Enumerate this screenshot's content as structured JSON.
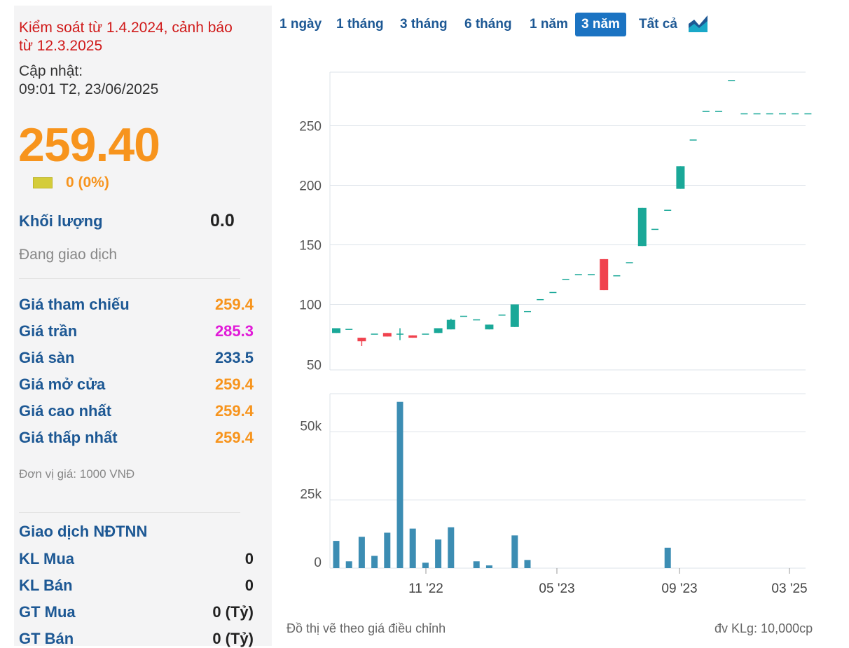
{
  "sidebar": {
    "warning": "Kiểm soát từ 1.4.2024, cảnh báo từ 12.3.2025",
    "update_label": "Cập nhật:",
    "update_time": "09:01 T2, 23/06/2025",
    "price": "259.40",
    "change": "0 (0%)",
    "volume_label": "Khối lượng",
    "volume_value": "0.0",
    "status": "Đang giao dịch",
    "stats": [
      {
        "label": "Giá tham chiếu",
        "value": "259.4",
        "color": "#f7941d"
      },
      {
        "label": "Giá trần",
        "value": "285.3",
        "color": "#e11bd8"
      },
      {
        "label": "Giá sàn",
        "value": "233.5",
        "color": "#1d5894"
      },
      {
        "label": "Giá mở cửa",
        "value": "259.4",
        "color": "#f7941d"
      },
      {
        "label": "Giá cao nhất",
        "value": "259.4",
        "color": "#f7941d"
      },
      {
        "label": "Giá thấp nhất",
        "value": "259.4",
        "color": "#f7941d"
      }
    ],
    "unit": "Đơn vị giá: 1000 VNĐ",
    "foreign_title": "Giao dịch NĐTNN",
    "foreign": [
      {
        "label": "KL Mua",
        "value": "0"
      },
      {
        "label": "KL Bán",
        "value": "0"
      },
      {
        "label": "GT Mua",
        "value": "0 (Tỷ)"
      },
      {
        "label": "GT Bán",
        "value": "0 (Tỷ)"
      }
    ]
  },
  "tabs": [
    "1 ngày",
    "1 tháng",
    "3 tháng",
    "6 tháng",
    "1 năm",
    "3 năm",
    "Tất cả"
  ],
  "active_tab": "3 năm",
  "chart_icon": "area-chart-icon",
  "footer": {
    "note": "Đồ thị vẽ theo giá điều chỉnh",
    "unit": "đv KLg: 10,000cp"
  },
  "colors": {
    "up": "#1aa898",
    "down": "#f0424e",
    "volume": "#3c8db3",
    "grid": "#dde3ea"
  },
  "chart_data": {
    "type": "candlestick",
    "x_ticks": [
      "11 '22",
      "05 '23",
      "09 '23",
      "03 '25"
    ],
    "price_axis": {
      "ticks": [
        50,
        100,
        150,
        200,
        250
      ],
      "ylim": [
        45,
        295
      ]
    },
    "volume_axis": {
      "ticks": [
        "0",
        "25k",
        "50k"
      ],
      "tick_values": [
        0,
        25000,
        50000
      ],
      "ylim": [
        0,
        64000
      ]
    },
    "candles": [
      {
        "open": 76,
        "close": 80,
        "high": 80,
        "low": 76
      },
      {
        "open": 79,
        "close": 79,
        "high": 79,
        "low": 79
      },
      {
        "open": 72,
        "close": 69,
        "high": 72,
        "low": 65
      },
      {
        "open": 75,
        "close": 75,
        "high": 75,
        "low": 75
      },
      {
        "open": 76,
        "close": 73,
        "high": 76,
        "low": 73
      },
      {
        "open": 75,
        "close": 75,
        "high": 80,
        "low": 70
      },
      {
        "open": 74,
        "close": 72,
        "high": 74,
        "low": 72
      },
      {
        "open": 75,
        "close": 75,
        "high": 75,
        "low": 75
      },
      {
        "open": 76,
        "close": 80,
        "high": 80,
        "low": 76
      },
      {
        "open": 79,
        "close": 87,
        "high": 88,
        "low": 79
      },
      {
        "open": 90,
        "close": 90,
        "high": 90,
        "low": 90
      },
      {
        "open": 87,
        "close": 87,
        "high": 87,
        "low": 87
      },
      {
        "open": 79,
        "close": 83,
        "high": 83,
        "low": 79
      },
      {
        "open": 91,
        "close": 91,
        "high": 91,
        "low": 91
      },
      {
        "open": 81,
        "close": 100,
        "high": 100,
        "low": 81
      },
      {
        "open": 94,
        "close": 94,
        "high": 94,
        "low": 94
      },
      {
        "open": 104,
        "close": 104,
        "high": 104,
        "low": 104
      },
      {
        "open": 110,
        "close": 110,
        "high": 110,
        "low": 110
      },
      {
        "open": 121,
        "close": 121,
        "high": 121,
        "low": 121
      },
      {
        "open": 125,
        "close": 125,
        "high": 125,
        "low": 125
      },
      {
        "open": 125,
        "close": 125,
        "high": 125,
        "low": 125
      },
      {
        "open": 138,
        "close": 112,
        "high": 138,
        "low": 112
      },
      {
        "open": 124,
        "close": 124,
        "high": 124,
        "low": 124
      },
      {
        "open": 135,
        "close": 135,
        "high": 135,
        "low": 135
      },
      {
        "open": 149,
        "close": 181,
        "high": 181,
        "low": 149
      },
      {
        "open": 163,
        "close": 163,
        "high": 163,
        "low": 163
      },
      {
        "open": 179,
        "close": 179,
        "high": 179,
        "low": 179
      },
      {
        "open": 197,
        "close": 216,
        "high": 216,
        "low": 197
      },
      {
        "open": 238,
        "close": 238,
        "high": 238,
        "low": 238
      },
      {
        "open": 262,
        "close": 262,
        "high": 262,
        "low": 262
      },
      {
        "open": 262,
        "close": 262,
        "high": 262,
        "low": 262
      },
      {
        "open": 288,
        "close": 288,
        "high": 288,
        "low": 288
      },
      {
        "open": 260,
        "close": 260,
        "high": 260,
        "low": 260
      },
      {
        "open": 260,
        "close": 260,
        "high": 260,
        "low": 260
      },
      {
        "open": 260,
        "close": 260,
        "high": 260,
        "low": 260
      },
      {
        "open": 260,
        "close": 260,
        "high": 260,
        "low": 260
      },
      {
        "open": 260,
        "close": 260,
        "high": 260,
        "low": 260
      },
      {
        "open": 260,
        "close": 260,
        "high": 260,
        "low": 260
      }
    ],
    "volume": [
      10000,
      2500,
      11500,
      4500,
      13000,
      61000,
      14500,
      2000,
      10500,
      15000,
      0,
      2500,
      1000,
      0,
      12000,
      3000,
      0,
      0,
      0,
      0,
      0,
      0,
      0,
      0,
      0,
      0,
      7500,
      0,
      0,
      0,
      0,
      0,
      0,
      0,
      0,
      0,
      0,
      0
    ]
  }
}
